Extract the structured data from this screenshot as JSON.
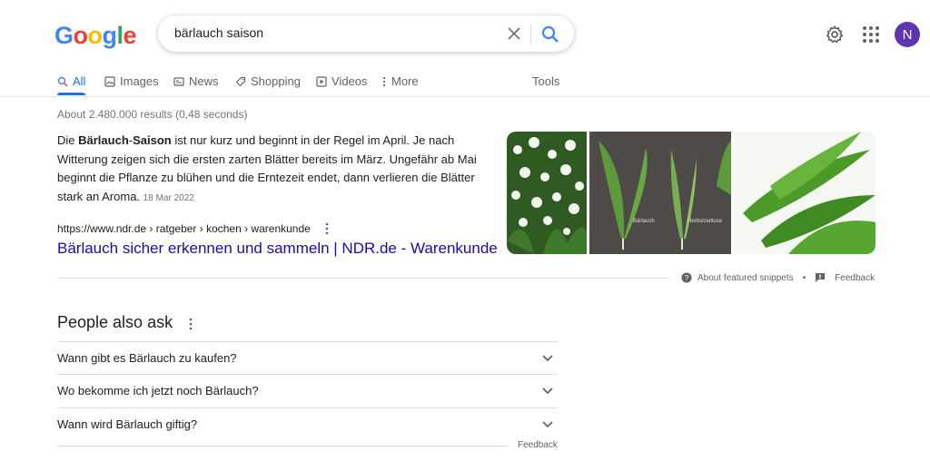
{
  "header": {
    "logo_letters": [
      "G",
      "o",
      "o",
      "g",
      "l",
      "e"
    ],
    "search_value": "bärlauch saison",
    "avatar_letter": "N",
    "icons": [
      "close-icon",
      "search-icon",
      "gear-icon",
      "apps-grid-icon"
    ]
  },
  "tabs": [
    {
      "label": "All",
      "icon": "search-icon",
      "active": true
    },
    {
      "label": "Images",
      "icon": "image-icon"
    },
    {
      "label": "News",
      "icon": "news-icon"
    },
    {
      "label": "Shopping",
      "icon": "tag-icon"
    },
    {
      "label": "Videos",
      "icon": "play-icon"
    },
    {
      "label": "More",
      "icon": "more-vert-icon"
    },
    {
      "label": "Tools"
    }
  ],
  "results_stats": "About 2.480.000 results (0,48 seconds)",
  "featured": {
    "snippet_pre": "Die ",
    "snippet_bold1": "Bärlauch",
    "snippet_mid": "-",
    "snippet_bold2": "Saison",
    "snippet_post": " ist nur kurz und beginnt in der Regel im April. Je nach Witterung zeigen sich die ersten zarten Blätter bereits im März. Ungefähr ab Mai beginnt die Pflanze zu blühen und die Erntezeit endet, dann verlieren die Blätter stark an Aroma.",
    "date": "18 Mar 2022",
    "url": "https://www.ndr.de › ratgeber › kochen › warenkunde",
    "title": "Bärlauch sicher erkennen und sammeln | NDR.de - Warenkunde",
    "image_labels": {
      "left": "Bärlauch",
      "right": "Herbstzeitlose"
    },
    "about_label": "About featured snippets",
    "dot": "•",
    "feedback_label": "Feedback"
  },
  "paa": {
    "title": "People also ask",
    "questions": [
      "Wann gibt es Bärlauch zu kaufen?",
      "Wo bekomme ich jetzt noch Bärlauch?",
      "Wann wird Bärlauch giftig?"
    ],
    "feedback_label": "Feedback"
  },
  "colors": {
    "link": "#1a0dab",
    "accent": "#1a73e8",
    "avatar": "#5e35b1"
  }
}
